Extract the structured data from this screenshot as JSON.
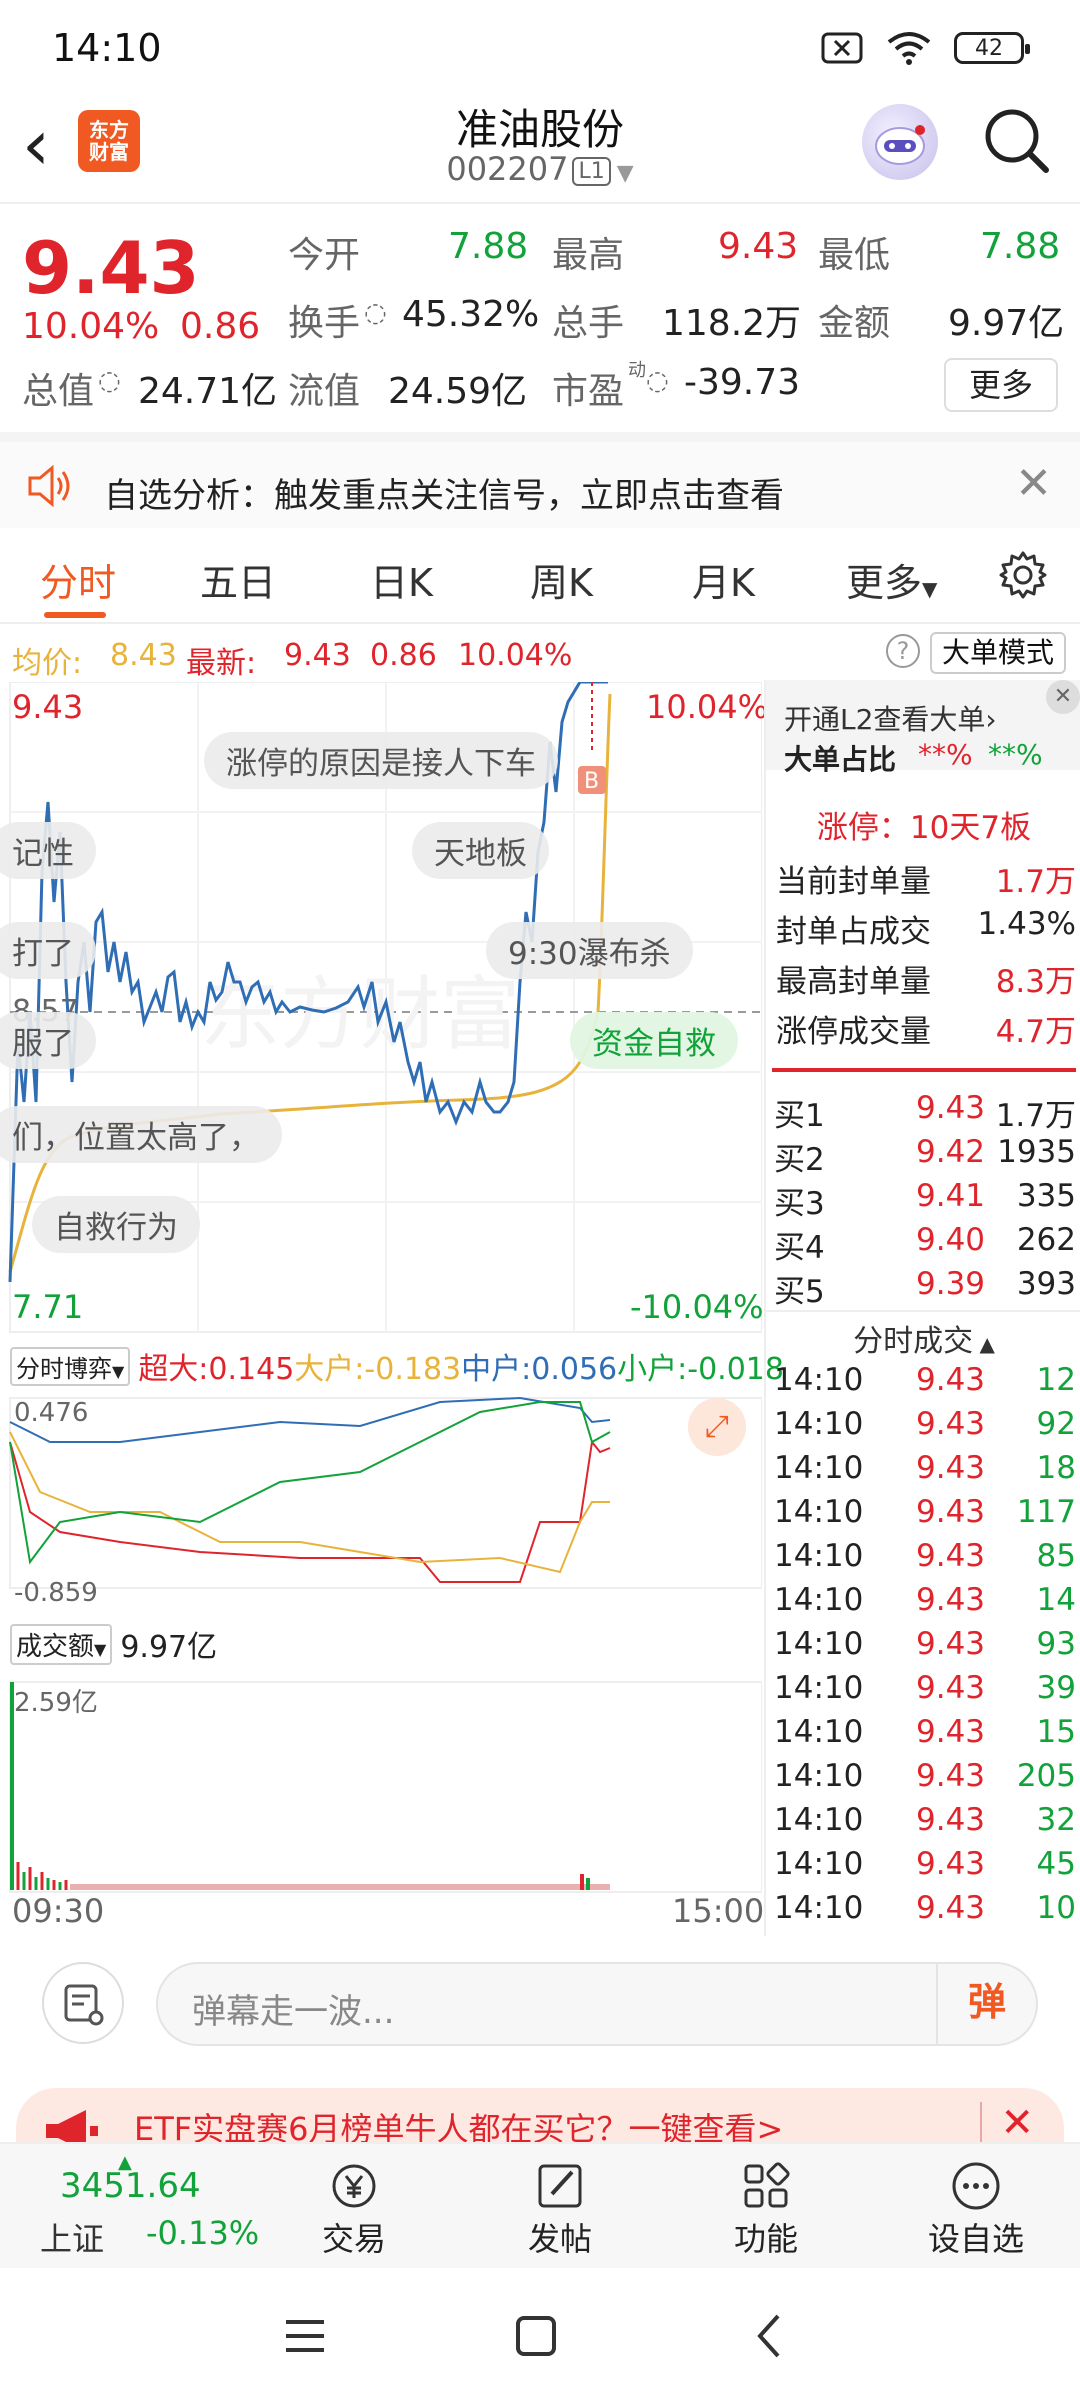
{
  "status_bar": {
    "time": "14:10",
    "battery": "42"
  },
  "header": {
    "logo_line1": "东方",
    "logo_line2": "财富",
    "title": "准油股份",
    "code": "002207",
    "level": "L1"
  },
  "quote": {
    "price": "9.43",
    "change_pct": "10.04%",
    "change": "0.86",
    "open_label": "今开",
    "open": "7.88",
    "high_label": "最高",
    "high": "9.43",
    "low_label": "最低",
    "low": "7.88",
    "turnover_label": "换手",
    "turnover": "45.32%",
    "volume_label": "总手",
    "volume": "118.2万",
    "amount_label": "金额",
    "amount": "9.97亿",
    "mktcap_label": "总值",
    "mktcap": "24.71亿",
    "float_label": "流值",
    "float": "24.59亿",
    "pe_label": "市盈",
    "pe_sup": "动",
    "pe": "-39.73",
    "more": "更多"
  },
  "notice": {
    "text": "自选分析：触发重点关注信号，立即点击查看"
  },
  "tabs": [
    "分时",
    "五日",
    "日K",
    "周K",
    "月K",
    "更多"
  ],
  "infoline": {
    "avg_label": "均价:",
    "avg": "8.43",
    "latest_label": "最新:",
    "latest": "9.43",
    "latest_chg": "0.86",
    "latest_pct": "10.04%",
    "big_mode": "大单模式"
  },
  "chart": {
    "top_left": "9.43",
    "top_right": "10.04%",
    "bottom_left": "7.71",
    "bottom_right": "-10.04%",
    "mid_label": "8.57",
    "game_label": "分时博弈",
    "super_label": "超大:0.145",
    "big_label": "大户:-0.183",
    "mid_hold_label": "中户:0.056",
    "small_label": "小户:-0.018",
    "game_top": "0.476",
    "game_bottom": "-0.859",
    "amount_label": "成交额",
    "amount_value": "9.97亿",
    "amount_top": "2.59亿",
    "time_start": "09:30",
    "time_end": "15:00",
    "bubbles": [
      "涨停的原因是接人下车",
      "天地板",
      "记性",
      "打了",
      "9:30瀑布杀",
      "服了",
      "资金自救",
      "们，位置太高了，",
      "自救行为"
    ]
  },
  "chart_data": {
    "type": "line",
    "x": [
      "09:30",
      "15:00"
    ],
    "ylim": [
      7.71,
      9.43
    ],
    "series": []
  },
  "right_panel": {
    "l2_text": "开通L2查看大单",
    "big_ratio_label": "大单占比",
    "big_ratio_red": "**%",
    "big_ratio_green": "**%",
    "limit_up": "涨停：10天7板",
    "stats": [
      {
        "label": "当前封单量",
        "value": "1.7万"
      },
      {
        "label": "封单占成交",
        "value": "1.43%"
      },
      {
        "label": "最高封单量",
        "value": "8.3万"
      },
      {
        "label": "涨停成交量",
        "value": "4.7万"
      }
    ],
    "bids": [
      {
        "label": "买1",
        "price": "9.43",
        "vol": "1.7万"
      },
      {
        "label": "买2",
        "price": "9.42",
        "vol": "1935"
      },
      {
        "label": "买3",
        "price": "9.41",
        "vol": "335"
      },
      {
        "label": "买4",
        "price": "9.40",
        "vol": "262"
      },
      {
        "label": "买5",
        "price": "9.39",
        "vol": "393"
      }
    ],
    "ticks_title": "分时成交",
    "ticks": [
      {
        "t": "14:10",
        "p": "9.43",
        "v": "12",
        "c": "green"
      },
      {
        "t": "14:10",
        "p": "9.43",
        "v": "92",
        "c": "green"
      },
      {
        "t": "14:10",
        "p": "9.43",
        "v": "18",
        "c": "green"
      },
      {
        "t": "14:10",
        "p": "9.43",
        "v": "117",
        "c": "green"
      },
      {
        "t": "14:10",
        "p": "9.43",
        "v": "85",
        "c": "green"
      },
      {
        "t": "14:10",
        "p": "9.43",
        "v": "14",
        "c": "green"
      },
      {
        "t": "14:10",
        "p": "9.43",
        "v": "93",
        "c": "green"
      },
      {
        "t": "14:10",
        "p": "9.43",
        "v": "39",
        "c": "green"
      },
      {
        "t": "14:10",
        "p": "9.43",
        "v": "15",
        "c": "green"
      },
      {
        "t": "14:10",
        "p": "9.43",
        "v": "205",
        "c": "green"
      },
      {
        "t": "14:10",
        "p": "9.43",
        "v": "32",
        "c": "green"
      },
      {
        "t": "14:10",
        "p": "9.43",
        "v": "45",
        "c": "green"
      },
      {
        "t": "14:10",
        "p": "9.43",
        "v": "10",
        "c": "green"
      }
    ]
  },
  "comment": {
    "placeholder": "弹幕走一波...",
    "dan": "弹"
  },
  "promo": {
    "text": "ETF实盘赛6月榜单牛人都在买它？一键查看>"
  },
  "bottom_nav": {
    "index_value": "3451.64",
    "index_name": "上证",
    "index_change": "-0.13%",
    "trade": "交易",
    "post": "发帖",
    "function": "功能",
    "add_fav": "设自选"
  },
  "colors": {
    "up": "#e0242c",
    "down": "#12a23a",
    "accent": "#f05a22",
    "price_line": "#2f6db5",
    "avg_line": "#e8b33b"
  }
}
